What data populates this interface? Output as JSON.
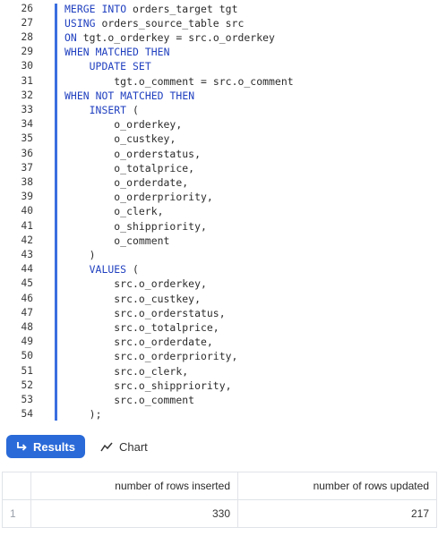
{
  "editor": {
    "lines": [
      {
        "n": "26",
        "code": "MERGE INTO orders_target tgt"
      },
      {
        "n": "27",
        "code": "USING orders_source_table src"
      },
      {
        "n": "28",
        "code": "ON tgt.o_orderkey = src.o_orderkey"
      },
      {
        "n": "29",
        "code": "WHEN MATCHED THEN"
      },
      {
        "n": "30",
        "code": "    UPDATE SET"
      },
      {
        "n": "31",
        "code": "        tgt.o_comment = src.o_comment"
      },
      {
        "n": "32",
        "code": "WHEN NOT MATCHED THEN"
      },
      {
        "n": "33",
        "code": "    INSERT ("
      },
      {
        "n": "34",
        "code": "        o_orderkey,"
      },
      {
        "n": "35",
        "code": "        o_custkey,"
      },
      {
        "n": "36",
        "code": "        o_orderstatus,"
      },
      {
        "n": "37",
        "code": "        o_totalprice,"
      },
      {
        "n": "38",
        "code": "        o_orderdate,"
      },
      {
        "n": "39",
        "code": "        o_orderpriority,"
      },
      {
        "n": "40",
        "code": "        o_clerk,"
      },
      {
        "n": "41",
        "code": "        o_shippriority,"
      },
      {
        "n": "42",
        "code": "        o_comment"
      },
      {
        "n": "43",
        "code": "    )"
      },
      {
        "n": "44",
        "code": "    VALUES ("
      },
      {
        "n": "45",
        "code": "        src.o_orderkey,"
      },
      {
        "n": "46",
        "code": "        src.o_custkey,"
      },
      {
        "n": "47",
        "code": "        src.o_orderstatus,"
      },
      {
        "n": "48",
        "code": "        src.o_totalprice,"
      },
      {
        "n": "49",
        "code": "        src.o_orderdate,"
      },
      {
        "n": "50",
        "code": "        src.o_orderpriority,"
      },
      {
        "n": "51",
        "code": "        src.o_clerk,"
      },
      {
        "n": "52",
        "code": "        src.o_shippriority,"
      },
      {
        "n": "53",
        "code": "        src.o_comment"
      },
      {
        "n": "54",
        "code": "    );"
      }
    ],
    "keywords": [
      "MERGE",
      "INTO",
      "USING",
      "ON",
      "WHEN",
      "MATCHED",
      "THEN",
      "UPDATE",
      "SET",
      "NOT",
      "INSERT",
      "VALUES"
    ]
  },
  "toolbar": {
    "results_label": "Results",
    "results_icon": "return-arrow-icon",
    "chart_label": "Chart",
    "chart_icon": "line-chart-icon",
    "accent": "#2a6ad8"
  },
  "results_table": {
    "columns": [
      "number of rows inserted",
      "number of rows updated"
    ],
    "rows": [
      {
        "index": "1",
        "values": [
          "330",
          "217"
        ]
      }
    ]
  }
}
